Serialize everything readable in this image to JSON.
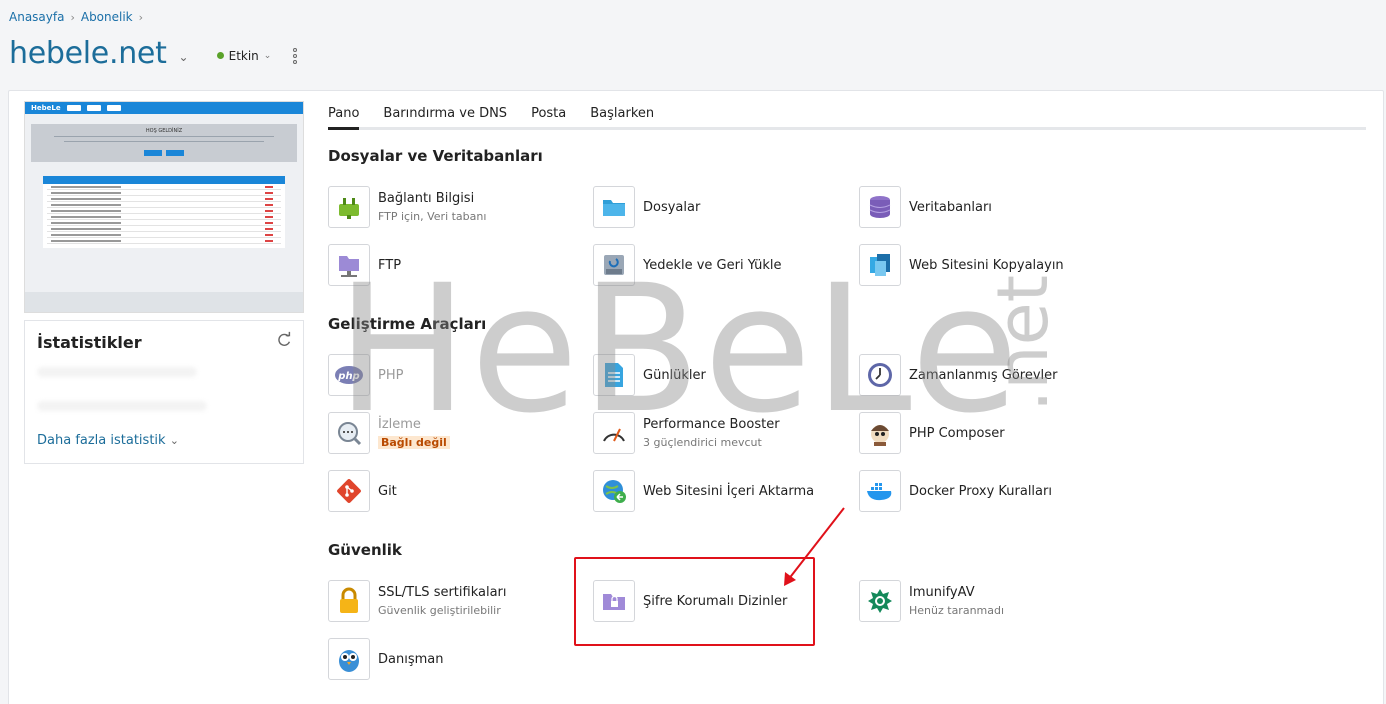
{
  "breadcrumb": {
    "items": [
      "Anasayfa",
      "Abonelik"
    ]
  },
  "header": {
    "title": "hebele.net",
    "status": "Etkin"
  },
  "preview": {
    "logo": "HebeLe",
    "banner": "HOŞ GELDİNİZ"
  },
  "stats": {
    "title": "İstatistikler",
    "more": "Daha fazla istatistik"
  },
  "tabs": [
    "Pano",
    "Barındırma ve DNS",
    "Posta",
    "Başlarken"
  ],
  "sections": {
    "files": "Dosyalar ve Veritabanları",
    "dev": "Geliştirme Araçları",
    "security": "Güvenlik"
  },
  "items": {
    "connection": {
      "name": "Bağlantı Bilgisi",
      "sub": "FTP için, Veri tabanı"
    },
    "files": {
      "name": "Dosyalar"
    },
    "databases": {
      "name": "Veritabanları"
    },
    "ftp": {
      "name": "FTP"
    },
    "backup": {
      "name": "Yedekle ve Geri Yükle"
    },
    "copy": {
      "name": "Web Sitesini Kopyalayın"
    },
    "php": {
      "name": "PHP"
    },
    "logs": {
      "name": "Günlükler"
    },
    "scheduled": {
      "name": "Zamanlanmış Görevler"
    },
    "monitor": {
      "name": "İzleme",
      "badge": "Bağlı değil"
    },
    "booster": {
      "name": "Performance Booster",
      "sub": "3 güçlendirici mevcut"
    },
    "composer": {
      "name": "PHP Composer"
    },
    "git": {
      "name": "Git"
    },
    "import": {
      "name": "Web Sitesini İçeri Aktarma"
    },
    "docker": {
      "name": "Docker Proxy Kuralları"
    },
    "ssl": {
      "name": "SSL/TLS sertifikaları",
      "sub": "Güvenlik geliştirilebilir"
    },
    "protected": {
      "name": "Şifre Korumalı Dizinler"
    },
    "imunify": {
      "name": "ImunifyAV",
      "sub": "Henüz taranmadı"
    },
    "advisor": {
      "name": "Danışman"
    }
  },
  "watermark": {
    "main": "HeBeLe",
    "suffix": ".net"
  },
  "colors": {
    "accent": "#1c6d9a",
    "highlight": "#e0111a",
    "status": "#5aa22a"
  }
}
